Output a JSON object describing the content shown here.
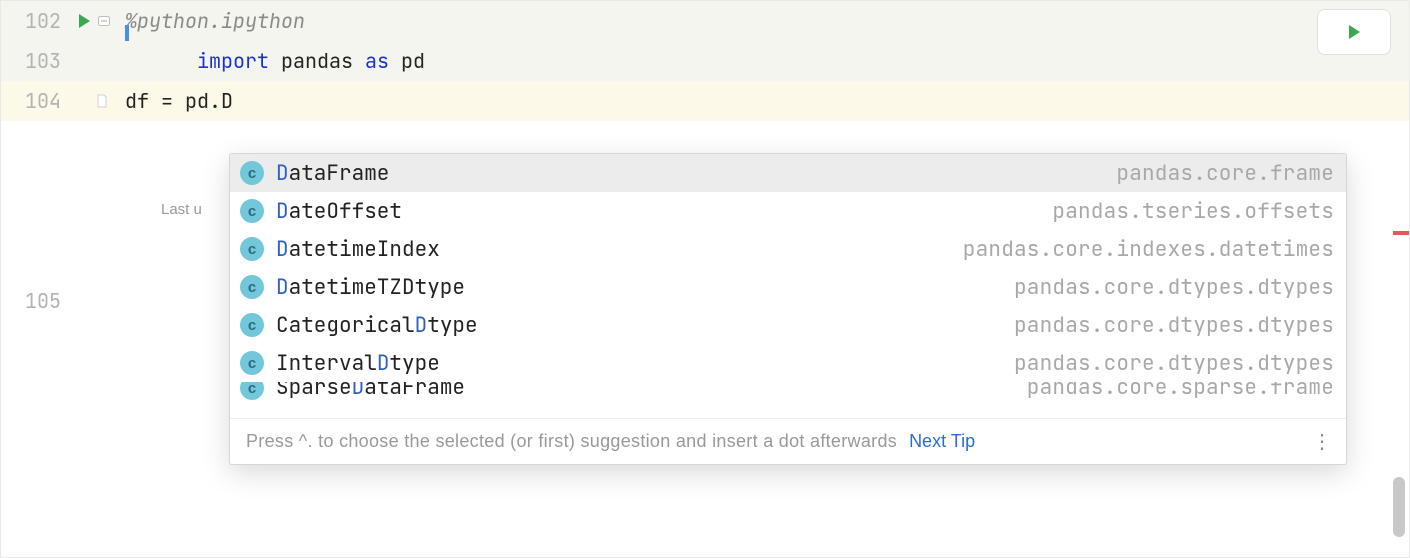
{
  "gutter": {
    "lines": [
      "102",
      "103",
      "104",
      "105"
    ]
  },
  "code": {
    "magic": "%python.ipython",
    "import_kw": "import",
    "import_mod": "pandas",
    "as_kw": "as",
    "alias": "pd",
    "line104": "df = pd.D"
  },
  "last_updated_label": "Last u",
  "completion": {
    "badge_letter": "c",
    "items": [
      {
        "pre": "D",
        "rest": "ataFrame",
        "module": "pandas.core.frame",
        "selected": true
      },
      {
        "pre": "D",
        "rest": "ateOffset",
        "module": "pandas.tseries.offsets",
        "selected": false
      },
      {
        "pre": "D",
        "rest": "atetimeIndex",
        "module": "pandas.core.indexes.datetimes",
        "selected": false
      },
      {
        "pre": "D",
        "rest": "atetimeTZDtype",
        "module": "pandas.core.dtypes.dtypes",
        "selected": false
      },
      {
        "preplain": "Categorical",
        "pre": "D",
        "rest": "type",
        "module": "pandas.core.dtypes.dtypes",
        "selected": false
      },
      {
        "preplain": "Interval",
        "pre": "D",
        "rest": "type",
        "module": "pandas.core.dtypes.dtypes",
        "selected": false
      }
    ],
    "partial": {
      "preplain": "Sparse",
      "pre": "D",
      "rest": "ataFrame",
      "module": "pandas.core.sparse.frame"
    },
    "footer_tip": "Press ^. to choose the selected (or first) suggestion and insert a dot afterwards",
    "next_tip": "Next Tip",
    "more": "⋮"
  }
}
